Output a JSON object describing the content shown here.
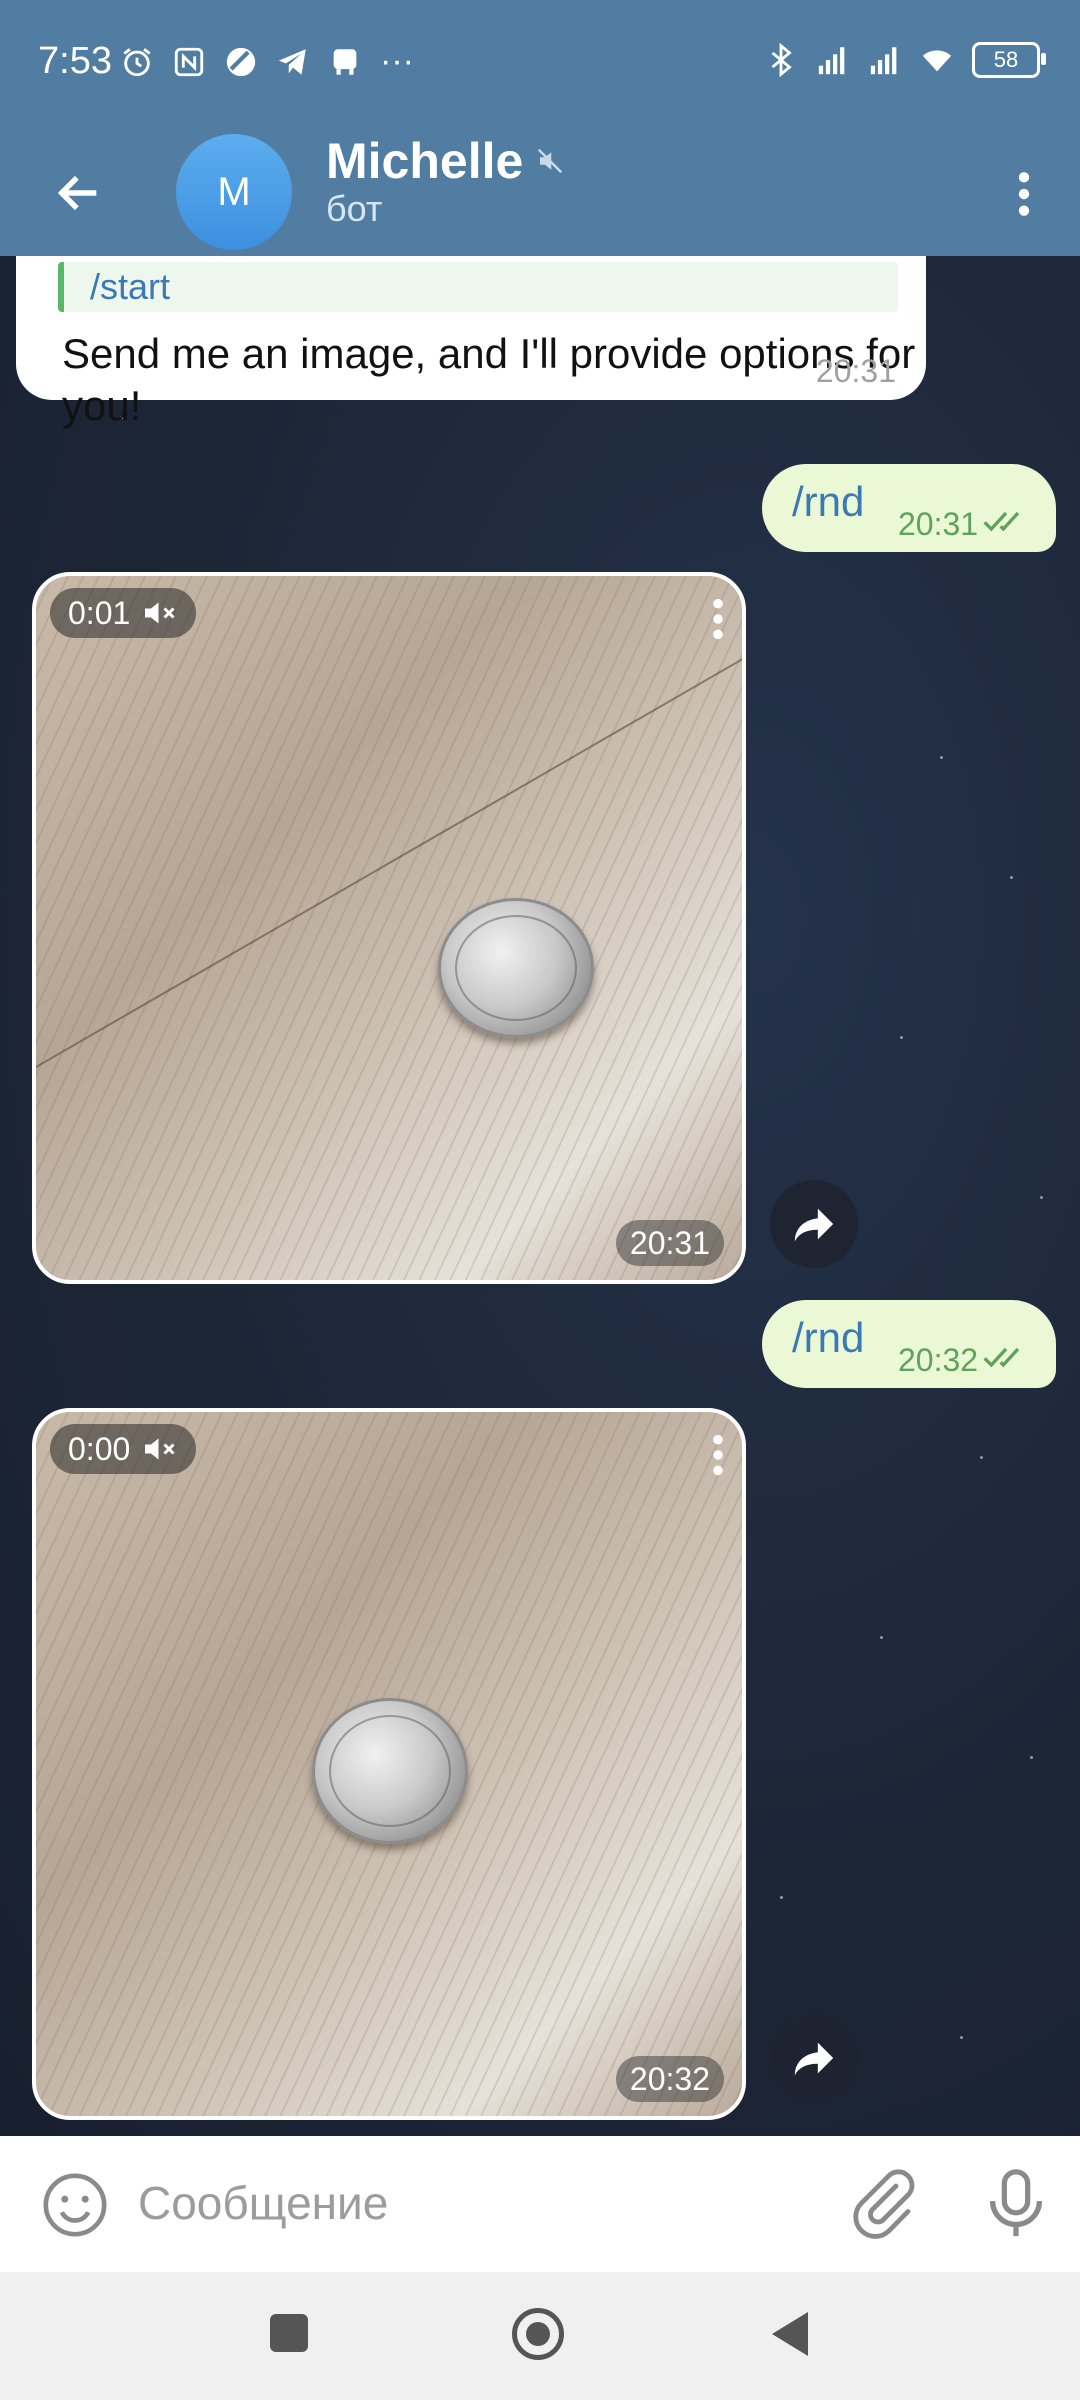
{
  "status_bar": {
    "time": "7:53",
    "battery": "58",
    "left_icons": [
      "alarm-icon",
      "nfc-icon",
      "app-icon",
      "telegram-icon",
      "bus-icon",
      "more-icon"
    ],
    "right_icons": [
      "bluetooth-icon",
      "signal-icon",
      "signal-icon",
      "wifi-icon"
    ],
    "more": "···"
  },
  "header": {
    "avatar_letter": "M",
    "title": "Michelle",
    "subtitle": "бот",
    "muted_icon": "mute-icon"
  },
  "messages": {
    "incoming_1": {
      "reply_text": "/start",
      "text": "Send me an image, and I'll provide options for you!",
      "time": "20:31"
    },
    "outgoing_1": {
      "text": "/rnd",
      "time": "20:31"
    },
    "video_1": {
      "duration": "0:01",
      "time": "20:31"
    },
    "outgoing_2": {
      "text": "/rnd",
      "time": "20:32"
    },
    "video_2": {
      "duration": "0:00",
      "time": "20:32"
    }
  },
  "input": {
    "placeholder": "Сообщение"
  },
  "colors": {
    "header": "#517da2",
    "outgoing_bubble": "#eaf8d6",
    "link": "#3a79b4",
    "check": "#5ea25c"
  }
}
